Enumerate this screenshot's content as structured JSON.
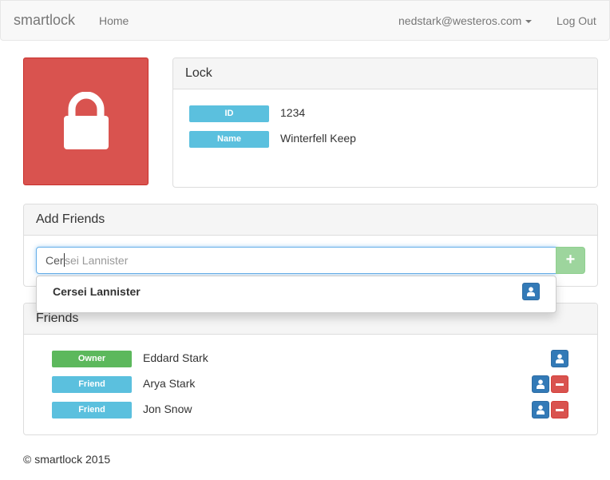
{
  "navbar": {
    "brand": "smartlock",
    "home": "Home",
    "user_email": "nedstark@westeros.com",
    "logout": "Log Out"
  },
  "lock_status": {
    "icon": "lock-icon",
    "color": "#d9534f"
  },
  "lock_panel": {
    "title": "Lock",
    "fields": [
      {
        "label": "ID",
        "value": "1234"
      },
      {
        "label": "Name",
        "value": "Winterfell Keep"
      }
    ]
  },
  "add_friends": {
    "title": "Add Friends",
    "input_typed": "Cer",
    "input_hint": "sei Lannister",
    "add_icon": "+",
    "suggestions": [
      {
        "name": "Cersei Lannister",
        "icon": "user-icon"
      }
    ]
  },
  "friends": {
    "title": "Friends",
    "rows": [
      {
        "role": "Owner",
        "name": "Eddard Stark"
      },
      {
        "role": "Friend",
        "name": "Arya Stark"
      },
      {
        "role": "Friend",
        "name": "Jon Snow"
      }
    ]
  },
  "footer": {
    "text": "© smartlock 2015"
  },
  "colors": {
    "danger": "#d9534f",
    "info": "#5bc0de",
    "success": "#5cb85c",
    "primary": "#337ab7"
  }
}
